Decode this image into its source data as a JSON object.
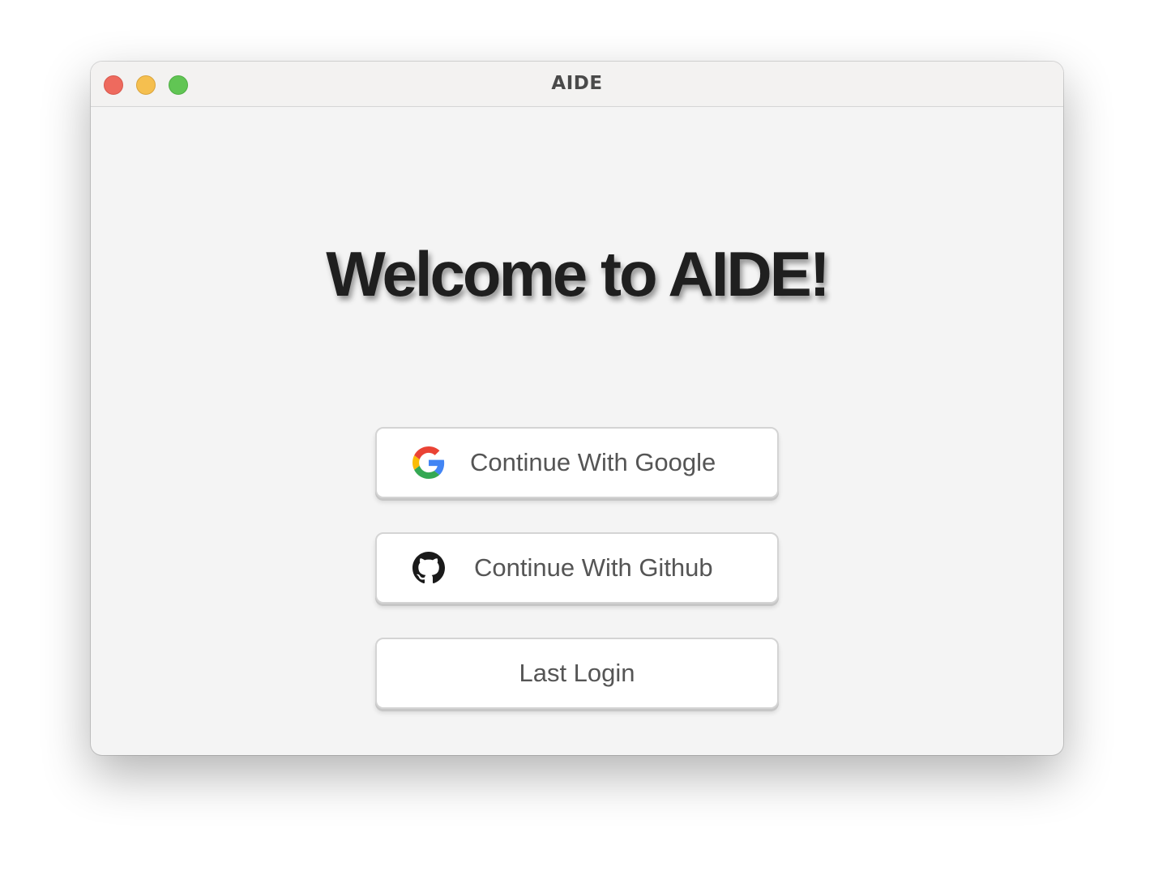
{
  "window": {
    "title": "AIDE"
  },
  "main": {
    "headline": "Welcome to AIDE!"
  },
  "buttons": {
    "google": {
      "label": "Continue With Google",
      "icon": "google-icon"
    },
    "github": {
      "label": "Continue With Github",
      "icon": "github-icon"
    },
    "last_login": {
      "label": "Last Login"
    }
  },
  "colors": {
    "close": "#ee6a5e",
    "minimize": "#f5bf4f",
    "maximize": "#61c554",
    "google_blue": "#4285F4",
    "google_red": "#EA4335",
    "google_yellow": "#FBBC05",
    "google_green": "#34A853"
  }
}
